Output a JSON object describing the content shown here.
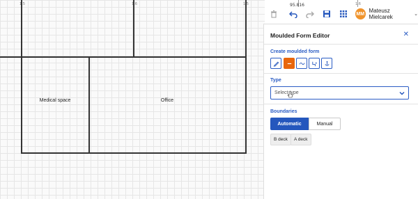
{
  "ruler": {
    "ticks": [
      "1.5",
      "1.6",
      "1.5",
      "1.6"
    ],
    "readout": "95.816"
  },
  "plan": {
    "rooms": [
      {
        "label": "Medical space"
      },
      {
        "label": "Office"
      }
    ]
  },
  "toolbar": {
    "icons": [
      "delete-icon",
      "undo-icon",
      "redo-icon",
      "save-icon",
      "grid-icon"
    ]
  },
  "user": {
    "initials": "MM",
    "name": "Mateusz Mielcarek"
  },
  "panel": {
    "title": "Moulded Form Editor",
    "create_label": "Create moulded form",
    "type_label": "Type",
    "select_placeholder": "Select type",
    "boundaries_label": "Boundaries",
    "mode_automatic": "Automatic",
    "mode_manual": "Manual",
    "decks": [
      "B deck",
      "A deck"
    ],
    "shape_tools": [
      "pencil-icon",
      "line-icon",
      "curve-icon",
      "step-icon",
      "anchor-icon"
    ],
    "active_tool_index": 1
  },
  "colors": {
    "accent": "#2557bd",
    "active_tool": "#e8660c",
    "avatar": "#f0932b"
  }
}
